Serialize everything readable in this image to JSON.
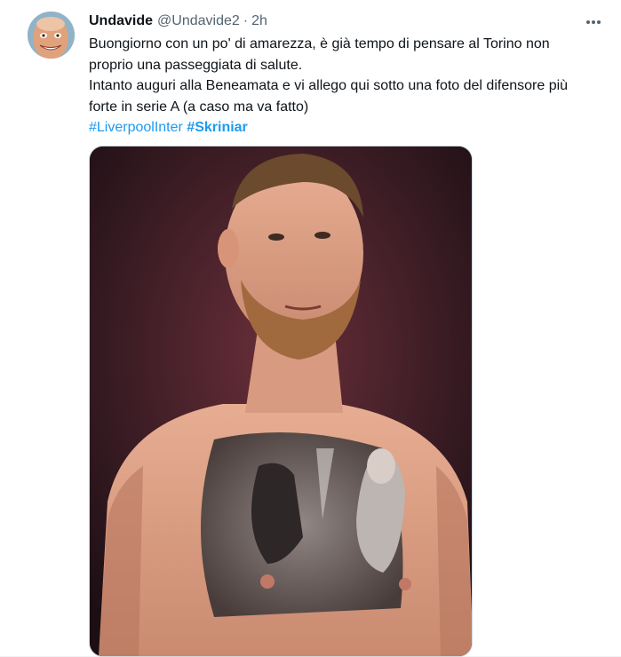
{
  "tweet": {
    "author": {
      "display_name": "Undavide",
      "handle": "@Undavide2"
    },
    "separator": "·",
    "timestamp": "2h",
    "text_lines": [
      "Buongiorno con un po' di amarezza, è già tempo di pensare al Torino non",
      "proprio una passeggiata di salute.",
      "Intanto auguri alla Beneamata e vi allego qui sotto una foto del difensore più",
      "forte in serie A (a caso ma va fatto)"
    ],
    "hashtags": [
      "#LiverpoolInter",
      "#Skriniar"
    ],
    "icons": {
      "more": "more-horizontal-icon",
      "avatar": "avatar-photo"
    },
    "colors": {
      "link": "#1d9bf0",
      "secondary_text": "#536471",
      "primary_text": "#0f1419"
    }
  }
}
